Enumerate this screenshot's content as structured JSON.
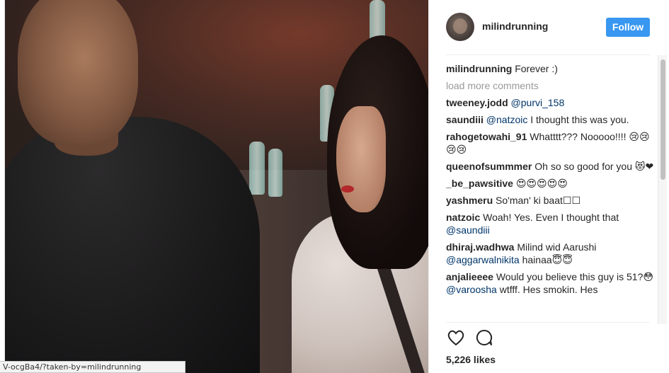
{
  "status_bar": {
    "url": "V-ocgBa4/?taken-by=milindrunning"
  },
  "header": {
    "username": "milindrunning",
    "follow_label": "Follow"
  },
  "caption": {
    "author": "milindrunning",
    "text": "Forever :)"
  },
  "load_more_label": "load more comments",
  "comments": [
    {
      "author": "tweeney.jodd",
      "parts": [
        {
          "type": "mention",
          "text": "@purvi_158"
        }
      ]
    },
    {
      "author": "saundiii",
      "parts": [
        {
          "type": "mention",
          "text": "@natzoic"
        },
        {
          "type": "text",
          "text": " I thought this was you."
        }
      ]
    },
    {
      "author": "rahogetowahi_91",
      "parts": [
        {
          "type": "text",
          "text": "Whatttt??? Nooooo!!!! 😢😢😢😢"
        }
      ]
    },
    {
      "author": "queenofsummmer",
      "parts": [
        {
          "type": "text",
          "text": "Oh so so good for you 😻❤"
        }
      ]
    },
    {
      "author": "_be_pawsitive",
      "parts": [
        {
          "type": "text",
          "text": "😍😍😍😍😍"
        }
      ]
    },
    {
      "author": "yashmeru",
      "parts": [
        {
          "type": "text",
          "text": "So'man' ki baat☐☐"
        }
      ]
    },
    {
      "author": "natzoic",
      "parts": [
        {
          "type": "text",
          "text": "Woah! Yes. Even I thought that "
        },
        {
          "type": "mention",
          "text": "@saundiii"
        }
      ]
    },
    {
      "author": "dhiraj.wadhwa",
      "parts": [
        {
          "type": "text",
          "text": "Milind wid Aarushi "
        },
        {
          "type": "mention",
          "text": "@aggarwalnikita"
        },
        {
          "type": "text",
          "text": " hainaa😇😇"
        }
      ]
    },
    {
      "author": "anjalieeee",
      "parts": [
        {
          "type": "text",
          "text": "Would you believe this guy is 51?😳"
        },
        {
          "type": "mention",
          "text": "@varoosha"
        },
        {
          "type": "text",
          "text": " wtfff. Hes smokin. Hes"
        }
      ]
    }
  ],
  "actions": {
    "like_icon": "heart-icon",
    "comment_icon": "comment-bubble-icon"
  },
  "likes_label": "5,226 likes",
  "colors": {
    "follow_button": "#3897f0",
    "mention": "#003569",
    "muted": "#999999"
  }
}
